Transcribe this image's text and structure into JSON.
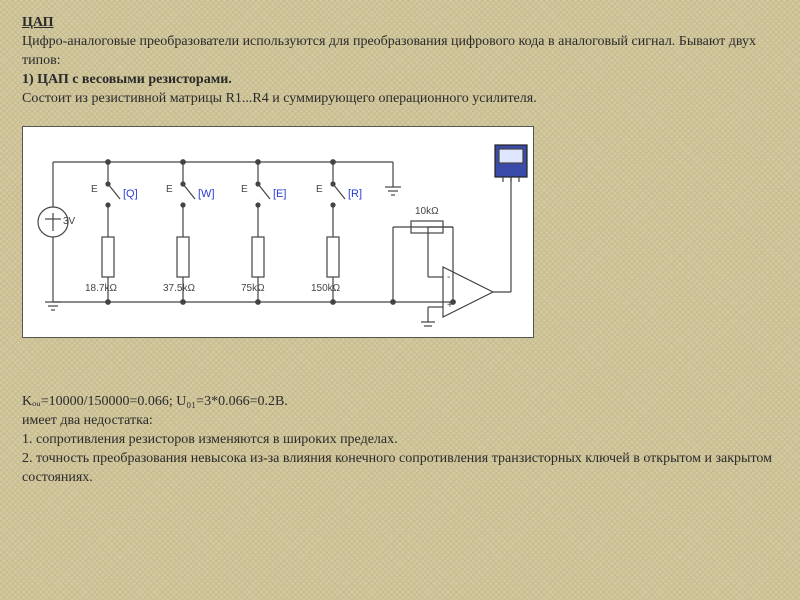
{
  "header": {
    "title": "ЦАП",
    "intro": "Цифро-аналоговые преобразователи используются для преобразования цифрового кода в аналоговый сигнал. Бывают двух типов:",
    "type1": "1) ЦАП с весовыми резисторами.",
    "desc1": "Состоит из резистивной матрицы R1...R4 и суммирующего операционного усилителя."
  },
  "circuit": {
    "vsource": "3V",
    "switch_prefix_1": "E",
    "switch_prefix_2": "E",
    "switch_prefix_3": "E",
    "switch_prefix_4": "E",
    "key1": "[Q]",
    "key2": "[W]",
    "key3": "[E]",
    "key4": "[R]",
    "r1": "18.7kΩ",
    "r2": "37.5kΩ",
    "r3": "75kΩ",
    "r4": "150kΩ",
    "rf": "10kΩ",
    "opamp_plus": "+",
    "opamp_minus": "-"
  },
  "footer": {
    "formula": "Kₒᵤ=10000/150000=0.066; U₀₁=3*0.066=0.2В.",
    "prelist": "имеет два недостатка:",
    "item1": "1. сопротивления резисторов изменяются в широких пределах.",
    "item2": "2. точность преобразования невысока из-за влияния конечного сопротивления транзисторных ключей в открытом и закрытом состояниях."
  }
}
